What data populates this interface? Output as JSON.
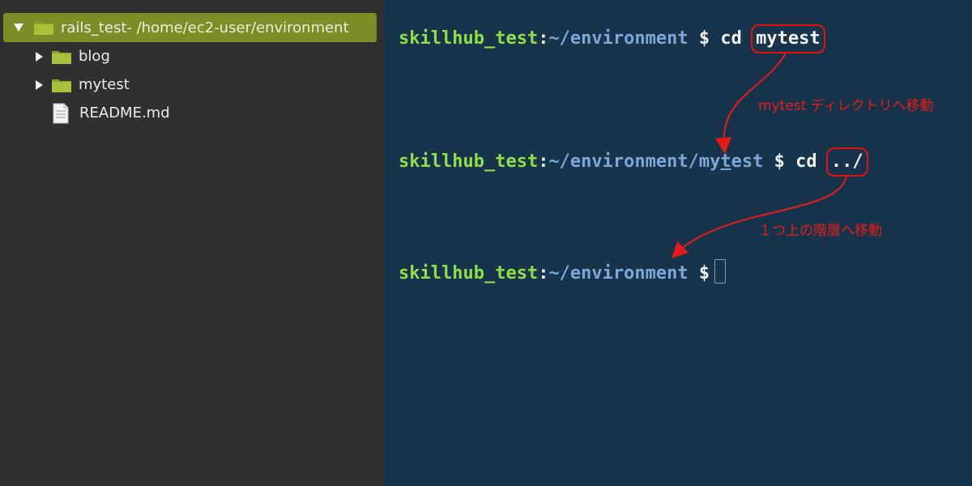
{
  "file_tree": {
    "root": {
      "name": "rails_test",
      "path": " - /home/ec2-user/environment",
      "expanded": true,
      "icon": "folder-icon"
    },
    "items": [
      {
        "name": "blog",
        "type": "folder",
        "icon": "folder-icon"
      },
      {
        "name": "mytest",
        "type": "folder",
        "icon": "folder-icon"
      },
      {
        "name": "README.md",
        "type": "file",
        "icon": "file-icon"
      }
    ]
  },
  "terminal": {
    "lines": [
      {
        "user": "skillhub_test",
        "colon": ":",
        "path": "~/environment",
        "dollar": " $ ",
        "command": "cd",
        "arg": "mytest"
      },
      {
        "user": "skillhub_test",
        "colon": ":",
        "path_a": "~/environment/my",
        "path_b": "t",
        "path_c": "est",
        "dollar": " $ ",
        "command": "cd",
        "arg": "../"
      },
      {
        "user": "skillhub_test",
        "colon": ":",
        "path": "~/environment",
        "dollar": " $"
      }
    ],
    "annotations": [
      "mytest ディレクトリへ移動",
      "１つ上の階層へ移動"
    ]
  },
  "colors": {
    "sidebar_bg": "#303030",
    "selected_row": "#7b8e27",
    "terminal_bg": "#17344a",
    "prompt_user": "#8ee04a",
    "prompt_path": "#7aa8d8",
    "highlight": "#e01212"
  }
}
